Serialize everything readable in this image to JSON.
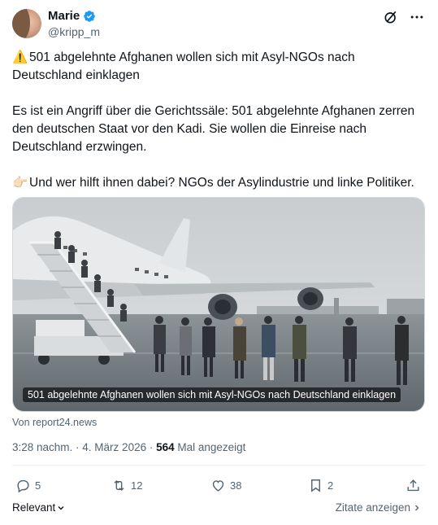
{
  "author": {
    "display_name": "Marie",
    "handle": "@kripp_m",
    "verified": true,
    "verified_color": "#1d9bf0"
  },
  "post": {
    "headline_emoji": "⚠️",
    "headline": "501 abgelehnte Afghanen wollen sich mit Asyl-NGOs nach Deutschland einklagen",
    "paragraph2": "Es ist ein Angriff über die Gerichtssäle: 501 abgelehnte Afghanen zerren den deutschen Staat vor den Kadi. Sie wollen die Einreise nach Deutschland erzwingen.",
    "paragraph3_emoji": "👉🏻",
    "paragraph3": "Und wer hilft ihnen dabei? NGOs der Asylindustrie und linke Politiker."
  },
  "media": {
    "caption": "501 abgelehnte Afghanen wollen sich mit Asyl-NGOs nach Deutschland einklagen",
    "source": "Von report24.news"
  },
  "meta": {
    "time": "3:28 nachm.",
    "separator": " · ",
    "date": "4. März 2026",
    "views_count": "564",
    "views_label": " Mal angezeigt"
  },
  "actions": {
    "replies": "5",
    "reposts": "12",
    "likes": "38",
    "bookmarks": "2"
  },
  "footer": {
    "sort_label": "Relevant",
    "quotes_label": "Zitate anzeigen"
  },
  "icons": {
    "verified": "verified-badge-icon",
    "grok": "grok-icon",
    "more": "more-icon",
    "reply": "reply-icon",
    "repost": "repost-icon",
    "like": "heart-icon",
    "bookmark": "bookmark-icon",
    "share": "share-icon"
  }
}
